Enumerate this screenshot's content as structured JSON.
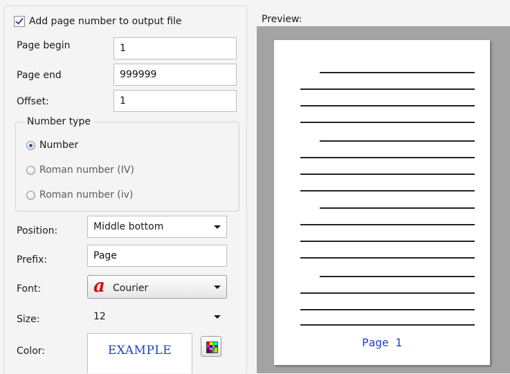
{
  "settings": {
    "add_page_number_label": "Add page number to output file",
    "add_page_number_checked": true,
    "page_begin": {
      "label": "Page begin",
      "value": "1"
    },
    "page_end": {
      "label": "Page end",
      "value": "999999"
    },
    "offset": {
      "label": "Offset:",
      "value": "1"
    },
    "number_type": {
      "title": "Number type",
      "options": [
        "Number",
        "Roman number (IV)",
        "Roman number (iv)"
      ],
      "selected": "Number"
    },
    "position": {
      "label": "Position:",
      "value": "Middle bottom"
    },
    "prefix": {
      "label": "Prefix:",
      "value": "Page"
    },
    "font": {
      "label": "Font:",
      "value": "Courier",
      "icon": "font-glyph-a-icon",
      "icon_glyph": "a",
      "icon_color": "#d01010"
    },
    "size": {
      "label": "Size:",
      "value": "12"
    },
    "color": {
      "label": "Color:",
      "sample_text": "EXAMPLE",
      "value": "#2040c8",
      "button_icon": "color-palette-icon"
    }
  },
  "preview": {
    "label": "Preview:",
    "page_number_text": "Page 1",
    "page_number_color": "#2040c8"
  }
}
